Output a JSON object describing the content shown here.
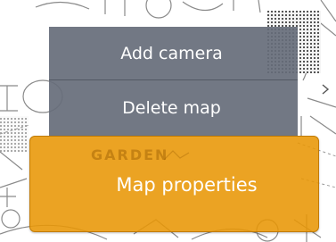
{
  "context_menu": {
    "items": [
      {
        "label": "Add camera",
        "state": "normal"
      },
      {
        "label": "Delete map",
        "state": "normal"
      },
      {
        "label": "Map properties",
        "state": "highlighted"
      }
    ],
    "colors": {
      "item_background": "#666c7a",
      "highlight_background": "#e89605",
      "text": "#ffffff"
    }
  },
  "map": {
    "area_label": "GARDEN"
  }
}
